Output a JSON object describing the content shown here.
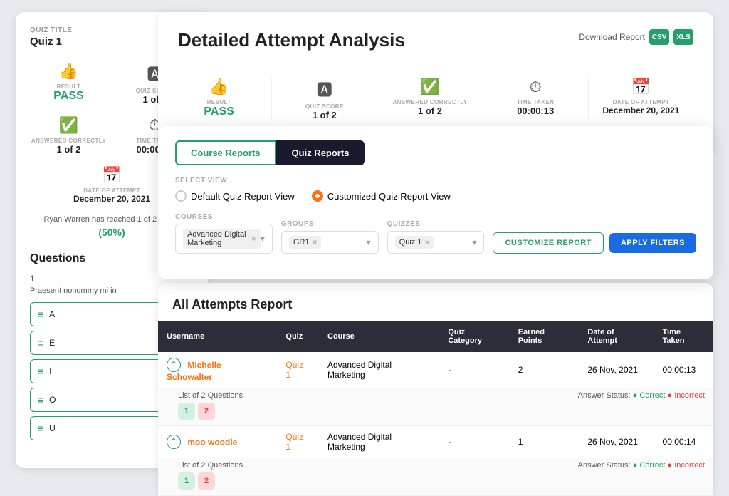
{
  "page": {
    "title": "Detailed Attempt Analysis",
    "download_report_label": "Download Report"
  },
  "quiz": {
    "title_label": "QUIZ TITLE",
    "title": "Quiz 1"
  },
  "stats": {
    "result_label": "RESULT",
    "result_value": "PASS",
    "quiz_score_label": "QUIZ SCORE",
    "quiz_score_value": "1 of 2",
    "answered_correctly_label": "ANSWERED CORRECTLY",
    "answered_correctly_value": "1 of 2",
    "time_taken_label": "TIME TAKEN",
    "time_taken_value": "00:00:13",
    "date_of_attempt_label": "DATE OF ATTEMPT",
    "date_of_attempt_value": "December 20, 2021"
  },
  "reached_text": "Ryan Warren has reached 1 of 2 points",
  "percent": "(50%)",
  "questions": {
    "title": "Questions",
    "number": "1.",
    "text": "Praesent nonummy mi in",
    "options": [
      {
        "letter": "A"
      },
      {
        "letter": "E"
      },
      {
        "letter": "I"
      },
      {
        "letter": "O"
      },
      {
        "letter": "U"
      }
    ]
  },
  "reports": {
    "tab_course": "Course Reports",
    "tab_quiz": "Quiz Reports",
    "select_view_label": "SELECT VIEW",
    "view_default_label": "Default Quiz Report View",
    "view_custom_label": "Customized Quiz Report View",
    "courses_label": "COURSES",
    "courses_value": "Advanced Digital Marketing",
    "groups_label": "GROUPS",
    "groups_value": "GR1",
    "quizzes_label": "QUIZZES",
    "quizzes_value": "Quiz 1",
    "btn_customize": "CUSTOMIZE REPORT",
    "btn_apply": "APPLY FILTERS"
  },
  "attempts": {
    "title": "All Attempts Report",
    "columns": [
      "Username",
      "Quiz",
      "Course",
      "Quiz Category",
      "Earned Points",
      "Date of Attempt",
      "Time Taken"
    ],
    "rows": [
      {
        "username": "Michelle Schowalter",
        "quiz": "Quiz 1",
        "course": "Advanced Digital Marketing",
        "category": "-",
        "points": "2",
        "date": "26 Nov, 2021",
        "time": "00:00:13",
        "questions": [
          1,
          2
        ],
        "q_correct": [
          1
        ],
        "q_incorrect": [
          2
        ]
      },
      {
        "username": "moo woodle",
        "quiz": "Quiz 1",
        "course": "Advanced Digital Marketing",
        "category": "-",
        "points": "1",
        "date": "26 Nov, 2021",
        "time": "00:00:14",
        "questions": [
          1,
          2
        ],
        "q_correct": [
          1
        ],
        "q_incorrect": [
          2
        ]
      }
    ],
    "list_label": "List of 2 Questions",
    "answer_status_label": "Answer Status:",
    "correct_label": "Correct",
    "incorrect_label": "Incorrect"
  },
  "icons": {
    "thumbs_up": "👍",
    "grade": "🅰",
    "check_circle": "✓",
    "clock": "⏱",
    "calendar": "📅",
    "csv": "CSV",
    "xls": "XLS"
  }
}
